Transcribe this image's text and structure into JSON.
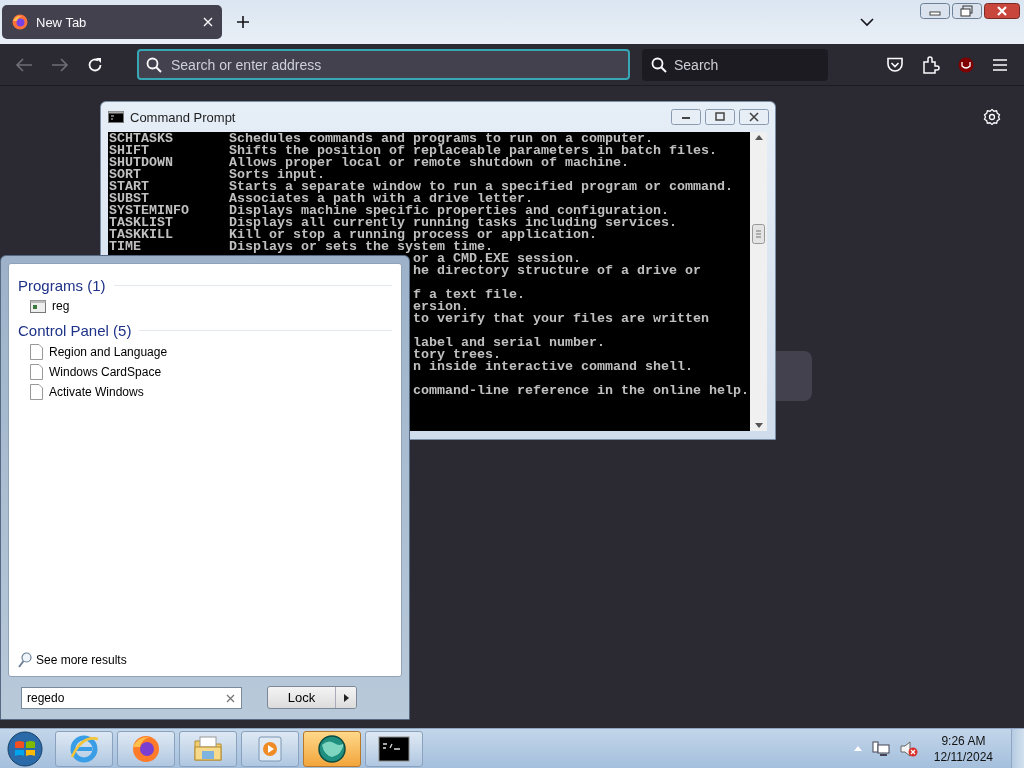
{
  "browser": {
    "tabs": [
      {
        "title": "New Tab",
        "selected": true
      }
    ],
    "address_bar": {
      "placeholder": "Search or enter address"
    },
    "search_bar": {
      "placeholder": "Search"
    }
  },
  "command_prompt": {
    "title": "Command Prompt",
    "lines": [
      {
        "command": "SCHTASKS",
        "description": "Schedules commands and programs to run on a computer."
      },
      {
        "command": "SHIFT",
        "description": "Shifts the position of replaceable parameters in batch files."
      },
      {
        "command": "SHUTDOWN",
        "description": "Allows proper local or remote shutdown of machine."
      },
      {
        "command": "SORT",
        "description": "Sorts input."
      },
      {
        "command": "START",
        "description": "Starts a separate window to run a specified program or command."
      },
      {
        "command": "SUBST",
        "description": "Associates a path with a drive letter."
      },
      {
        "command": "SYSTEMINFO",
        "description": "Displays machine specific properties and configuration."
      },
      {
        "command": "TASKLIST",
        "description": "Displays all currently running tasks including services."
      },
      {
        "command": "TASKKILL",
        "description": "Kill or stop a running process or application."
      },
      {
        "command": "TIME",
        "description": "Displays or sets the system time."
      }
    ],
    "partial_lines": [
      {
        "kind": "text",
        "text": "or a CMD.EXE session."
      },
      {
        "kind": "text",
        "text": "he directory structure of a drive or"
      },
      {
        "kind": "blank"
      },
      {
        "kind": "text",
        "text": "f a text file."
      },
      {
        "kind": "text",
        "text": "ersion."
      },
      {
        "kind": "text",
        "text": "to verify that your files are written"
      },
      {
        "kind": "blank"
      },
      {
        "kind": "text",
        "text": "label and serial number."
      },
      {
        "kind": "text",
        "text": "tory trees."
      },
      {
        "kind": "text",
        "text": "n inside interactive command shell."
      },
      {
        "kind": "blank"
      },
      {
        "kind": "text",
        "text": "command-line reference in the online help."
      }
    ]
  },
  "start_menu": {
    "groups": [
      {
        "title": "Programs (1)",
        "items": [
          {
            "label": "reg",
            "kind": "program"
          }
        ]
      },
      {
        "title": "Control Panel (5)",
        "items": [
          {
            "label": "Region and Language",
            "kind": "document"
          },
          {
            "label": "Windows CardSpace",
            "kind": "document"
          },
          {
            "label": "Activate Windows",
            "kind": "document"
          }
        ]
      }
    ],
    "see_more": "See more results",
    "search_field": {
      "value": "regedo"
    },
    "power_button": "Lock"
  },
  "taskbar": {
    "apps": [
      {
        "kind": "ie",
        "active": false
      },
      {
        "kind": "firefox",
        "active": false
      },
      {
        "kind": "explorer",
        "active": false
      },
      {
        "kind": "media",
        "active": false
      },
      {
        "kind": "globe",
        "active": true
      },
      {
        "kind": "cmd",
        "active": false
      }
    ],
    "clock": {
      "time": "9:26 AM",
      "date": "12/11/2024"
    }
  }
}
